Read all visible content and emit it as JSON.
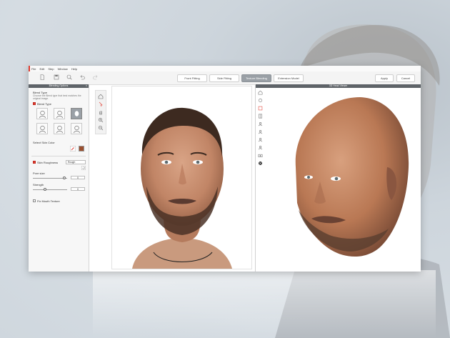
{
  "menu": [
    "File",
    "Edit",
    "Step",
    "Window",
    "Help"
  ],
  "toolbar": {
    "steps": [
      "Front Fitting",
      "Side Fitting",
      "Texture Blending",
      "Extension Model"
    ],
    "active_step": "Texture Blending",
    "apply": "Apply",
    "cancel": "Cancel",
    "icons": [
      "new-file-icon",
      "save-icon",
      "zoom-fit-icon",
      "undo-icon",
      "redo-icon"
    ]
  },
  "left_panel": {
    "title": "Blending Options",
    "blend_type_heading": "Blend Type",
    "blend_type_desc": "Choose the Blend type that best matches the original image.",
    "blend_type_checkbox": "Blend Type",
    "skin_color_label": "Select Skin Color",
    "skin_color": "#9a4f2e",
    "skin_roughness_label": "Skin Roughness",
    "skin_roughness_value": "Rough",
    "pore_size_label": "Pore size",
    "pore_size_value": "0",
    "strength_label": "Strength",
    "strength_value": "0",
    "fix_mouth_label": "Fix Mouth Texture"
  },
  "viewer": {
    "title": "3D Head Viewer"
  },
  "colors": {
    "accent": "#e03a2e",
    "header": "#5e6368"
  }
}
